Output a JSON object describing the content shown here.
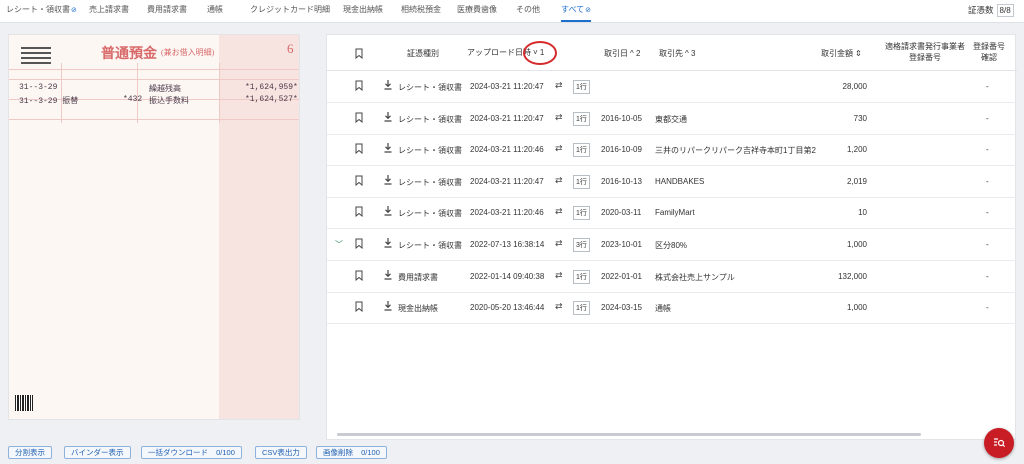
{
  "tabs": [
    {
      "label": "レシート・領収書",
      "mark": "⊘"
    },
    {
      "label": "売上請求書"
    },
    {
      "label": "費用請求書"
    },
    {
      "label": "通帳"
    },
    {
      "label": "クレジットカード明細"
    },
    {
      "label": "現金出納帳"
    },
    {
      "label": "相続税預金"
    },
    {
      "label": "医療費歯像"
    },
    {
      "label": "その他"
    },
    {
      "label": "すべて",
      "mark": "⊘",
      "active": true
    }
  ],
  "cert_count": {
    "label": "証憑数",
    "value": "8/8"
  },
  "preview": {
    "title": "普通預金",
    "subtitle": "(兼お借入明細)",
    "page_no": "6",
    "rows": [
      {
        "date": "31--3-29",
        "desc": "繰越残高",
        "amount": "*1,624,959*"
      },
      {
        "date": "31--3-29  振替",
        "fee": "*432",
        "desc": "振込手数料",
        "amount": "*1,624,527*"
      }
    ]
  },
  "table": {
    "headers": {
      "type": "証憑種別",
      "upload": "アップロード日時",
      "upload_sort": "˅ 1",
      "date": "取引日",
      "date_sort": "^ 2",
      "partner": "取引先",
      "partner_sort": "^ 3",
      "amount": "取引金額",
      "amount_sort": "⇕",
      "reg_no": "適格請求書発行事業者",
      "reg_no2": "登録番号",
      "reg_check": "登録番号",
      "reg_check2": "確認"
    },
    "rows": [
      {
        "type": "レシート・領収書",
        "uploaded": "2024-03-21 11:20:47",
        "lines": "1行",
        "date": "",
        "partner": "",
        "amount": "28,000",
        "reg": "-",
        "expanded": false
      },
      {
        "type": "レシート・領収書",
        "uploaded": "2024-03-21 11:20:47",
        "lines": "1行",
        "date": "2016-10-05",
        "partner": "東都交通",
        "amount": "730",
        "reg": "-",
        "expanded": false
      },
      {
        "type": "レシート・領収書",
        "uploaded": "2024-03-21 11:20:46",
        "lines": "1行",
        "date": "2016-10-09",
        "partner": "三井のリパークリパーク吉祥寺本町1丁目第2",
        "amount": "1,200",
        "reg": "-",
        "expanded": false
      },
      {
        "type": "レシート・領収書",
        "uploaded": "2024-03-21 11:20:47",
        "lines": "1行",
        "date": "2016-10-13",
        "partner": "HANDBAKES",
        "amount": "2,019",
        "reg": "-",
        "expanded": false
      },
      {
        "type": "レシート・領収書",
        "uploaded": "2024-03-21 11:20:46",
        "lines": "1行",
        "date": "2020-03-11",
        "partner": "FamilyMart",
        "amount": "10",
        "reg": "-",
        "expanded": false
      },
      {
        "type": "レシート・領収書",
        "uploaded": "2022-07-13 16:38:14",
        "lines": "3行",
        "date": "2023-10-01",
        "partner": "区分80%",
        "amount": "1,000",
        "reg": "-",
        "expanded": true
      },
      {
        "type": "費用請求書",
        "uploaded": "2022-01-14 09:40:38",
        "lines": "1行",
        "date": "2022-01-01",
        "partner": "株式会社売上サンプル",
        "amount": "132,000",
        "reg": "-",
        "expanded": false
      },
      {
        "type": "現金出納帳",
        "uploaded": "2020-05-20 13:46:44",
        "lines": "1行",
        "date": "2024-03-15",
        "partner": "通帳",
        "amount": "1,000",
        "reg": "-",
        "expanded": false
      }
    ]
  },
  "footer": {
    "split": "分割表示",
    "binder": "バインダー表示",
    "bulk_download": "一括ダウンロード",
    "bulk_count": "0/100",
    "csv": "CSV表出力",
    "delete": "画像削除",
    "delete_count": "0/100"
  },
  "fab_icon": "search-list-icon",
  "colors": {
    "accent": "#1f6fd1",
    "fab": "#c81d25",
    "highlight": "#d42a2a"
  }
}
